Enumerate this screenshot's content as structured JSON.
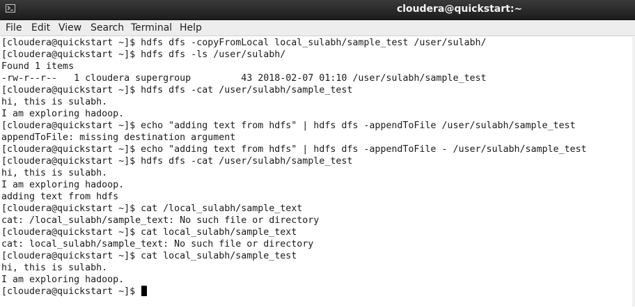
{
  "window": {
    "title": "cloudera@quickstart:~"
  },
  "menu": {
    "items": [
      "File",
      "Edit",
      "View",
      "Search",
      "Terminal",
      "Help"
    ]
  },
  "terminal": {
    "lines": [
      "[cloudera@quickstart ~]$ hdfs dfs -copyFromLocal local_sulabh/sample_test /user/sulabh/",
      "[cloudera@quickstart ~]$ hdfs dfs -ls /user/sulabh/",
      "Found 1 items",
      "-rw-r--r--   1 cloudera supergroup         43 2018-02-07 01:10 /user/sulabh/sample_test",
      "[cloudera@quickstart ~]$ hdfs dfs -cat /user/sulabh/sample_test",
      "hi, this is sulabh.",
      "I am exploring hadoop.",
      "[cloudera@quickstart ~]$ echo \"adding text from hdfs\" | hdfs dfs -appendToFile /user/sulabh/sample_test",
      "appendToFile: missing destination argument",
      "[cloudera@quickstart ~]$ echo \"adding text from hdfs\" | hdfs dfs -appendToFile - /user/sulabh/sample_test",
      "[cloudera@quickstart ~]$ hdfs dfs -cat /user/sulabh/sample_test",
      "hi, this is sulabh.",
      "I am exploring hadoop.",
      "adding text from hdfs",
      "[cloudera@quickstart ~]$ cat /local_sulabh/sample_text",
      "cat: /local_sulabh/sample_text: No such file or directory",
      "[cloudera@quickstart ~]$ cat local_sulabh/sample_text",
      "cat: local_sulabh/sample_text: No such file or directory",
      "[cloudera@quickstart ~]$ cat local_sulabh/sample_test",
      "hi, this is sulabh.",
      "I am exploring hadoop.",
      "[cloudera@quickstart ~]$ "
    ]
  }
}
